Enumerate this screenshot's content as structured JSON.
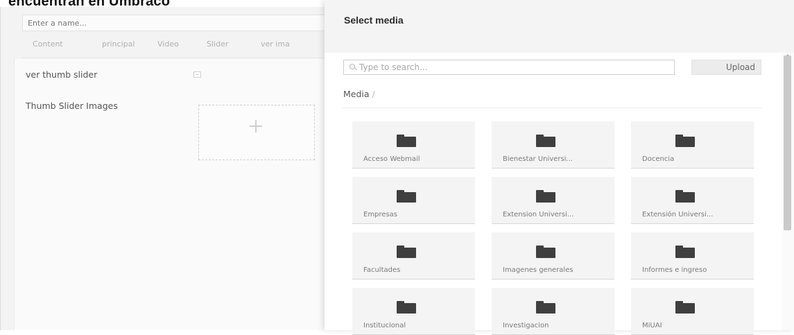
{
  "page": {
    "clipped_title": "encuentran en Umbraco"
  },
  "editor": {
    "name_placeholder": "Enter a name...",
    "tabs": [
      {
        "label": "Content"
      },
      {
        "label": "principal"
      },
      {
        "label": "Video"
      },
      {
        "label": "Slider"
      },
      {
        "label": "ver ima"
      }
    ],
    "properties": [
      {
        "label": "ver thumb slider"
      },
      {
        "label": "Thumb Slider Images"
      }
    ]
  },
  "dialog": {
    "title": "Select media",
    "search_placeholder": "Type to search...",
    "upload_label": "Upload",
    "breadcrumb_root": "Media",
    "breadcrumb_sep": "/",
    "folders": [
      {
        "label": "Acceso Webmail"
      },
      {
        "label": "Bienestar Universi..."
      },
      {
        "label": "Docencia"
      },
      {
        "label": "Empresas"
      },
      {
        "label": "Extension Universi..."
      },
      {
        "label": "Extensión Universi..."
      },
      {
        "label": "Facultades"
      },
      {
        "label": "Imagenes generales"
      },
      {
        "label": "Informes e ingreso"
      },
      {
        "label": "Institucional"
      },
      {
        "label": "Investigacion"
      },
      {
        "label": "MiUAI"
      }
    ]
  },
  "colors": {
    "dialog_header": "#f4f4f5",
    "folder_icon": "#3f3f3f",
    "tile_bg": "#f4f4f5"
  }
}
